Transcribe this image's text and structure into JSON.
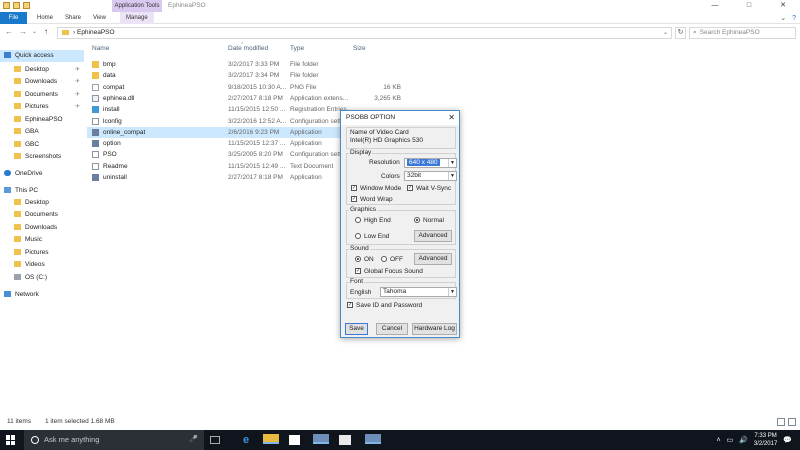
{
  "titlebar": {
    "app_tools": "Application Tools",
    "title": "EphineaPSO",
    "minimize": "—",
    "maximize": "□",
    "close": "✕"
  },
  "ribbon": {
    "tabs": [
      "File",
      "Home",
      "Share",
      "View",
      "Manage"
    ],
    "collapse": "⌄",
    "help": "?"
  },
  "address": {
    "path": "EphineaPSO",
    "separator": "›",
    "search_placeholder": "Search EphineaPSO",
    "back": "←",
    "forward": "→",
    "recent": "⌄",
    "up": "↑",
    "dropdown": "⌄",
    "refresh": "↻",
    "search_icon": "⌕"
  },
  "navpane": {
    "items": [
      {
        "label": "Quick access",
        "icon": "star-icon"
      },
      {
        "label": "Desktop",
        "icon": "folder-icon",
        "pinned": true
      },
      {
        "label": "Downloads",
        "icon": "folder-icon",
        "pinned": true
      },
      {
        "label": "Documents",
        "icon": "folder-icon",
        "pinned": true
      },
      {
        "label": "Pictures",
        "icon": "folder-icon",
        "pinned": true
      },
      {
        "label": "EphineaPSO",
        "icon": "folder-icon"
      },
      {
        "label": "GBA",
        "icon": "folder-icon"
      },
      {
        "label": "GBC",
        "icon": "folder-icon"
      },
      {
        "label": "Screenshots",
        "icon": "folder-icon"
      },
      {
        "label": "OneDrive",
        "icon": "cloud-icon"
      },
      {
        "label": "This PC",
        "icon": "computer-icon"
      },
      {
        "label": "Desktop",
        "icon": "folder-icon"
      },
      {
        "label": "Documents",
        "icon": "folder-icon"
      },
      {
        "label": "Downloads",
        "icon": "folder-icon"
      },
      {
        "label": "Music",
        "icon": "folder-icon"
      },
      {
        "label": "Pictures",
        "icon": "folder-icon"
      },
      {
        "label": "Videos",
        "icon": "folder-icon"
      },
      {
        "label": "OS (C:)",
        "icon": "disk-icon"
      },
      {
        "label": "Network",
        "icon": "network-icon"
      }
    ],
    "pin_glyph": "✈"
  },
  "filelist": {
    "columns": [
      "Name",
      "Date modified",
      "Type",
      "Size"
    ],
    "sort_glyph": "^",
    "rows": [
      {
        "name": "bmp",
        "date": "3/2/2017 3:33 PM",
        "type": "File folder",
        "size": "",
        "icon": "folder-icon"
      },
      {
        "name": "data",
        "date": "3/2/2017 3:34 PM",
        "type": "File folder",
        "size": "",
        "icon": "folder-icon"
      },
      {
        "name": "compat",
        "date": "9/18/2015 10:30 A...",
        "type": "PNG File",
        "size": "16 KB",
        "icon": "png-file-icon"
      },
      {
        "name": "ephinea.dll",
        "date": "2/27/2017 8:18 PM",
        "type": "Application extens...",
        "size": "3,265 KB",
        "icon": "dll-file-icon"
      },
      {
        "name": "install",
        "date": "11/15/2015 12:50 ...",
        "type": "Registration Entries",
        "size": "",
        "icon": "registry-file-icon"
      },
      {
        "name": "lconfig",
        "date": "3/22/2016 12:52 A...",
        "type": "Configuration setti...",
        "size": "",
        "icon": "config-file-icon"
      },
      {
        "name": "online_compat",
        "date": "2/6/2016 9:23 PM",
        "type": "Application",
        "size": "",
        "icon": "application-icon"
      },
      {
        "name": "option",
        "date": "11/15/2015 12:37 ...",
        "type": "Application",
        "size": "",
        "icon": "application-icon"
      },
      {
        "name": "PSO",
        "date": "3/25/2005 8:20 PM",
        "type": "Configuration setti...",
        "size": "",
        "icon": "config-file-icon"
      },
      {
        "name": "Readme",
        "date": "11/15/2015 12:49 ...",
        "type": "Text Document",
        "size": "",
        "icon": "text-file-icon"
      },
      {
        "name": "uninstall",
        "date": "2/27/2017 8:18 PM",
        "type": "Application",
        "size": "",
        "icon": "application-icon"
      }
    ],
    "selected_index": 6
  },
  "statusbar": {
    "items_count": "11 items",
    "selection": "1 item selected  1.68 MB"
  },
  "dialog": {
    "title": "PSOBB OPTION",
    "close": "✕",
    "video_card_label": "Name of Video Card",
    "video_card_value": "Intel(R) HD Graphics 530",
    "display_label": "Display",
    "resolution_label": "Resolution",
    "resolution_value": "640 x 480",
    "colors_label": "Colors",
    "colors_value": "32bit",
    "window_mode": "Window Mode",
    "wait_vsync": "Wait V-Sync",
    "word_wrap": "Word Wrap",
    "graphics_label": "Graphics",
    "high_end": "High End",
    "normal": "Normal",
    "low_end": "Low End",
    "advanced": "Advanced",
    "sound_label": "Sound",
    "on": "ON",
    "off": "OFF",
    "global_focus_sound": "Global Focus Sound",
    "font_label": "Font",
    "english_label": "English",
    "font_value": "Tahoma",
    "save_id_password": "Save ID and Password",
    "save": "Save",
    "cancel": "Cancel",
    "hardware_log": "Hardware Log",
    "check": "✓",
    "dropdown": "▼"
  },
  "taskbar": {
    "search_placeholder": "Ask me anything",
    "mic": "🎤",
    "time": "7:33 PM",
    "date": "3/2/2017",
    "tray_up": "˄",
    "volume": "🔊",
    "notifications": "💬"
  },
  "colors": {
    "accent": "#1979ca",
    "selection": "#cce8ff",
    "taskbar": "#10151d"
  }
}
